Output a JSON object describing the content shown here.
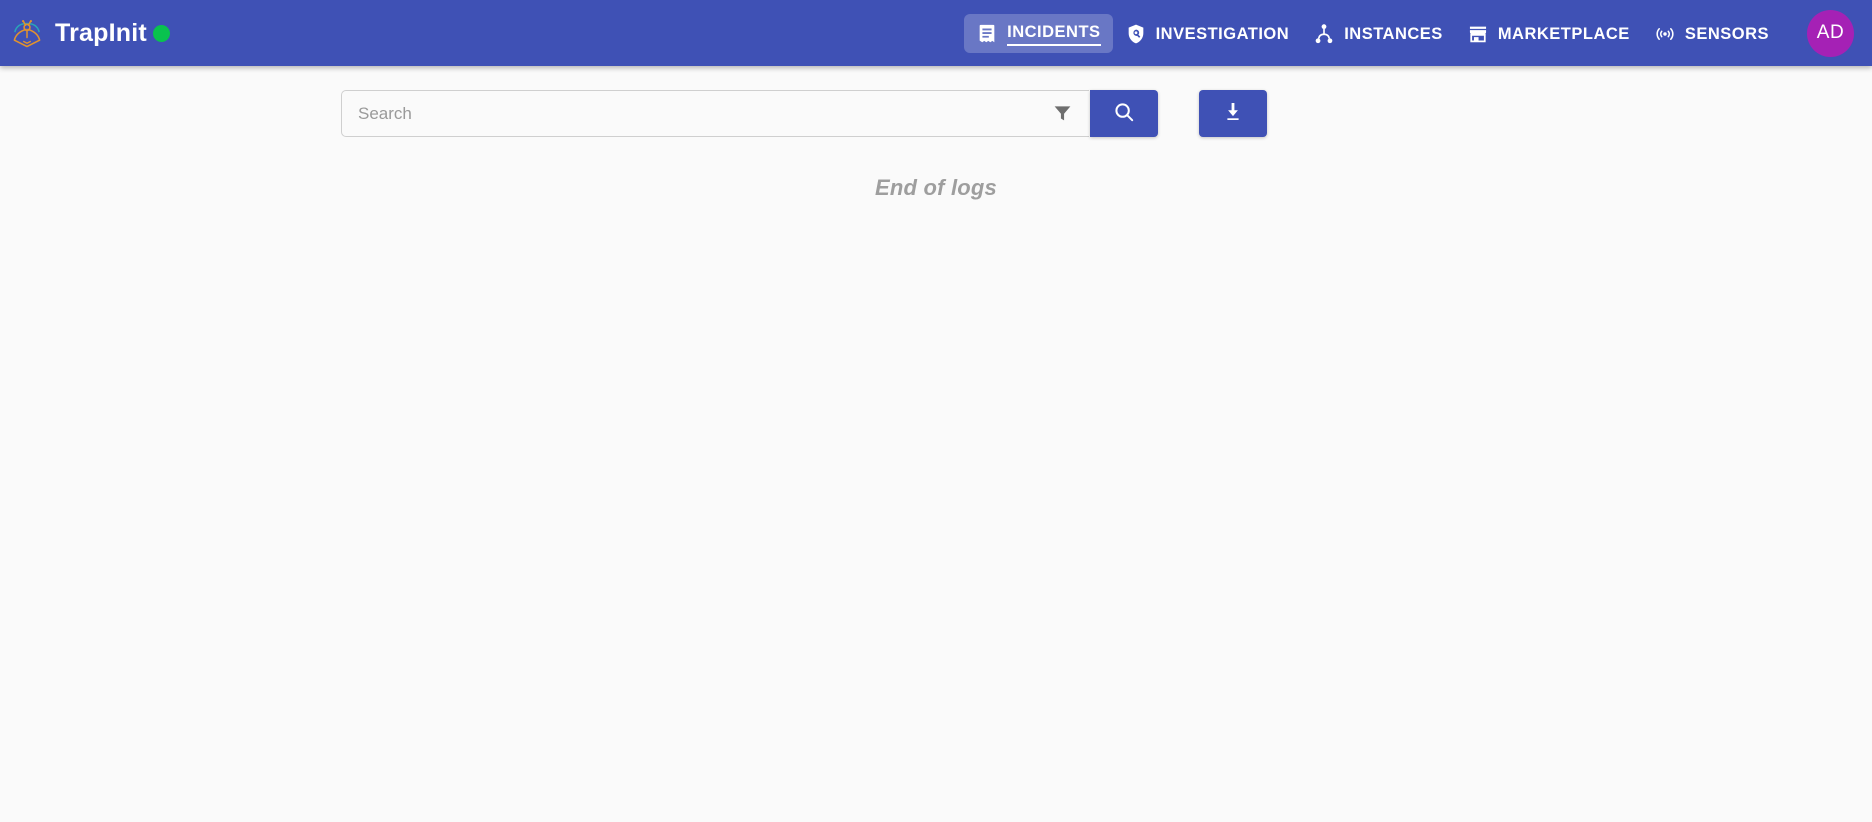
{
  "brand": {
    "name": "TrapInit",
    "logo_icon": "moth-trap-logo-icon",
    "status_dot_icon": "status-online-dot-icon",
    "status_color": "#09c24e"
  },
  "theme": {
    "appbar_bg": "#3f51b5",
    "page_bg": "#fafafa",
    "accent": "#3f51b5",
    "avatar_bg": "#a521b5",
    "muted_text": "#9e9e9e"
  },
  "nav": {
    "items": [
      {
        "label": "INCIDENTS",
        "icon": "receipt-long-icon",
        "active": true
      },
      {
        "label": "INVESTIGATION",
        "icon": "shield-search-icon",
        "active": false
      },
      {
        "label": "INSTANCES",
        "icon": "account-tree-icon",
        "active": false
      },
      {
        "label": "MARKETPLACE",
        "icon": "storefront-icon",
        "active": false
      },
      {
        "label": "SENSORS",
        "icon": "sensors-broadcast-icon",
        "active": false
      }
    ]
  },
  "account": {
    "initials": "AD",
    "avatar_icon": "user-avatar"
  },
  "search": {
    "value": "",
    "placeholder": "Search",
    "filter_icon": "filter-funnel-icon",
    "submit_icon": "magnifier-search-icon",
    "download_icon": "download-icon"
  },
  "main": {
    "end_of_logs": "End of logs"
  }
}
